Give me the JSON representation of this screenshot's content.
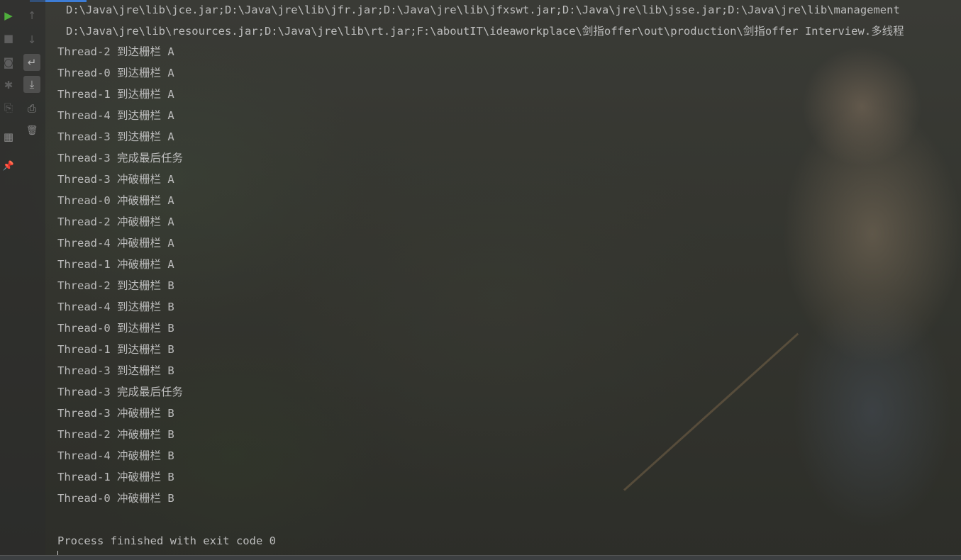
{
  "toolbar": {
    "buttons": [
      {
        "name": "run-icon",
        "glyph": "▶"
      },
      {
        "name": "stop-icon",
        "glyph": "■"
      },
      {
        "name": "camera-icon",
        "glyph": "◙"
      },
      {
        "name": "bug-icon",
        "glyph": "✱"
      },
      {
        "name": "restore-layout-icon",
        "glyph": "⎘"
      },
      {
        "name": "layout-icon",
        "glyph": "▦"
      },
      {
        "name": "pin-icon",
        "glyph": "📌"
      },
      {
        "name": "up-arrow-icon",
        "glyph": "↑"
      },
      {
        "name": "down-arrow-icon",
        "glyph": "↓"
      },
      {
        "name": "soft-wrap-icon",
        "glyph": "↵"
      },
      {
        "name": "scroll-to-end-icon",
        "glyph": "⤓"
      },
      {
        "name": "print-icon",
        "glyph": "⎙"
      },
      {
        "name": "trash-icon",
        "glyph": "🗑"
      }
    ]
  },
  "console": {
    "command_lines": [
      "D:\\Java\\jre\\lib\\jce.jar;D:\\Java\\jre\\lib\\jfr.jar;D:\\Java\\jre\\lib\\jfxswt.jar;D:\\Java\\jre\\lib\\jsse.jar;D:\\Java\\jre\\lib\\management",
      "D:\\Java\\jre\\lib\\resources.jar;D:\\Java\\jre\\lib\\rt.jar;F:\\aboutIT\\ideaworkplace\\剑指offer\\out\\production\\剑指offer Interview.多线程"
    ],
    "output_lines": [
      "Thread-2 到达栅栏 A",
      "Thread-0 到达栅栏 A",
      "Thread-1 到达栅栏 A",
      "Thread-4 到达栅栏 A",
      "Thread-3 到达栅栏 A",
      "Thread-3 完成最后任务",
      "Thread-3 冲破栅栏 A",
      "Thread-0 冲破栅栏 A",
      "Thread-2 冲破栅栏 A",
      "Thread-4 冲破栅栏 A",
      "Thread-1 冲破栅栏 A",
      "Thread-2 到达栅栏 B",
      "Thread-4 到达栅栏 B",
      "Thread-0 到达栅栏 B",
      "Thread-1 到达栅栏 B",
      "Thread-3 到达栅栏 B",
      "Thread-3 完成最后任务",
      "Thread-3 冲破栅栏 B",
      "Thread-2 冲破栅栏 B",
      "Thread-4 冲破栅栏 B",
      "Thread-1 冲破栅栏 B",
      "Thread-0 冲破栅栏 B"
    ],
    "exit_message": "Process finished with exit code 0"
  },
  "colors": {
    "console_text": "#bcbcbc",
    "run_green": "#4fae3c",
    "accent_blue": "#3d7dd6"
  }
}
